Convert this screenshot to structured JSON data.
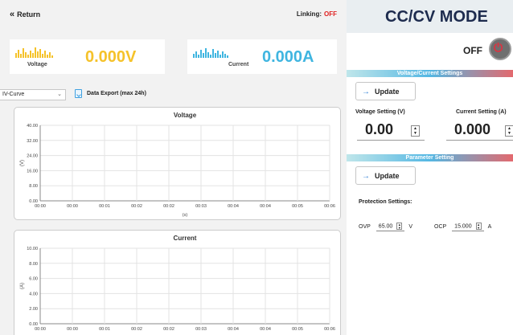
{
  "header": {
    "return_label": "Return",
    "return_icon": "double-chevron-left-icon",
    "linking_label": "Linking:",
    "linking_status": "OFF"
  },
  "readouts": {
    "voltage": {
      "label": "Voltage",
      "value": "0.000V",
      "color": "#f5c22a"
    },
    "current": {
      "label": "Current",
      "value": "0.000A",
      "color": "#3fb5e0"
    }
  },
  "toolbar": {
    "view_select": "IV-Curve",
    "export_label": "Data Export (max 24h)"
  },
  "chart_data": [
    {
      "type": "line",
      "title": "Voltage",
      "xlabel": "(s)",
      "ylabel": "(V)",
      "ylim": [
        0,
        40
      ],
      "yticks": [
        "0.00",
        "8.00",
        "16.00",
        "24.00",
        "32.00",
        "40.00"
      ],
      "xticks": [
        "00:00",
        "00:00",
        "00:01",
        "00:02",
        "00:02",
        "00:03",
        "00:04",
        "00:04",
        "00:05",
        "00:06"
      ],
      "grid": true,
      "series": []
    },
    {
      "type": "line",
      "title": "Current",
      "xlabel": "(s)",
      "ylabel": "(A)",
      "ylim": [
        0,
        10
      ],
      "yticks": [
        "0.00",
        "2.00",
        "4.00",
        "6.00",
        "8.00",
        "10.00"
      ],
      "xticks": [
        "00:00",
        "00:00",
        "00:01",
        "00:02",
        "00:02",
        "00:03",
        "00:04",
        "00:04",
        "00:05",
        "00:06"
      ],
      "grid": true,
      "series": []
    }
  ],
  "mode": {
    "title": "CC/CV MODE",
    "output_state": "OFF",
    "power_icon": "power-icon"
  },
  "vc_settings": {
    "section_title": "Voltage/Current Settings",
    "update_label": "Update",
    "voltage_label": "Voltage Setting (V)",
    "voltage_value": "0.00",
    "current_label": "Current Setting (A)",
    "current_value": "0.000"
  },
  "param_settings": {
    "section_title": "Parameter Setting",
    "update_label": "Update",
    "protection_label": "Protection Settings:",
    "ovp_label": "OVP",
    "ovp_value": "65.00",
    "ovp_unit": "V",
    "ocp_label": "OCP",
    "ocp_value": "15.000",
    "ocp_unit": "A"
  }
}
